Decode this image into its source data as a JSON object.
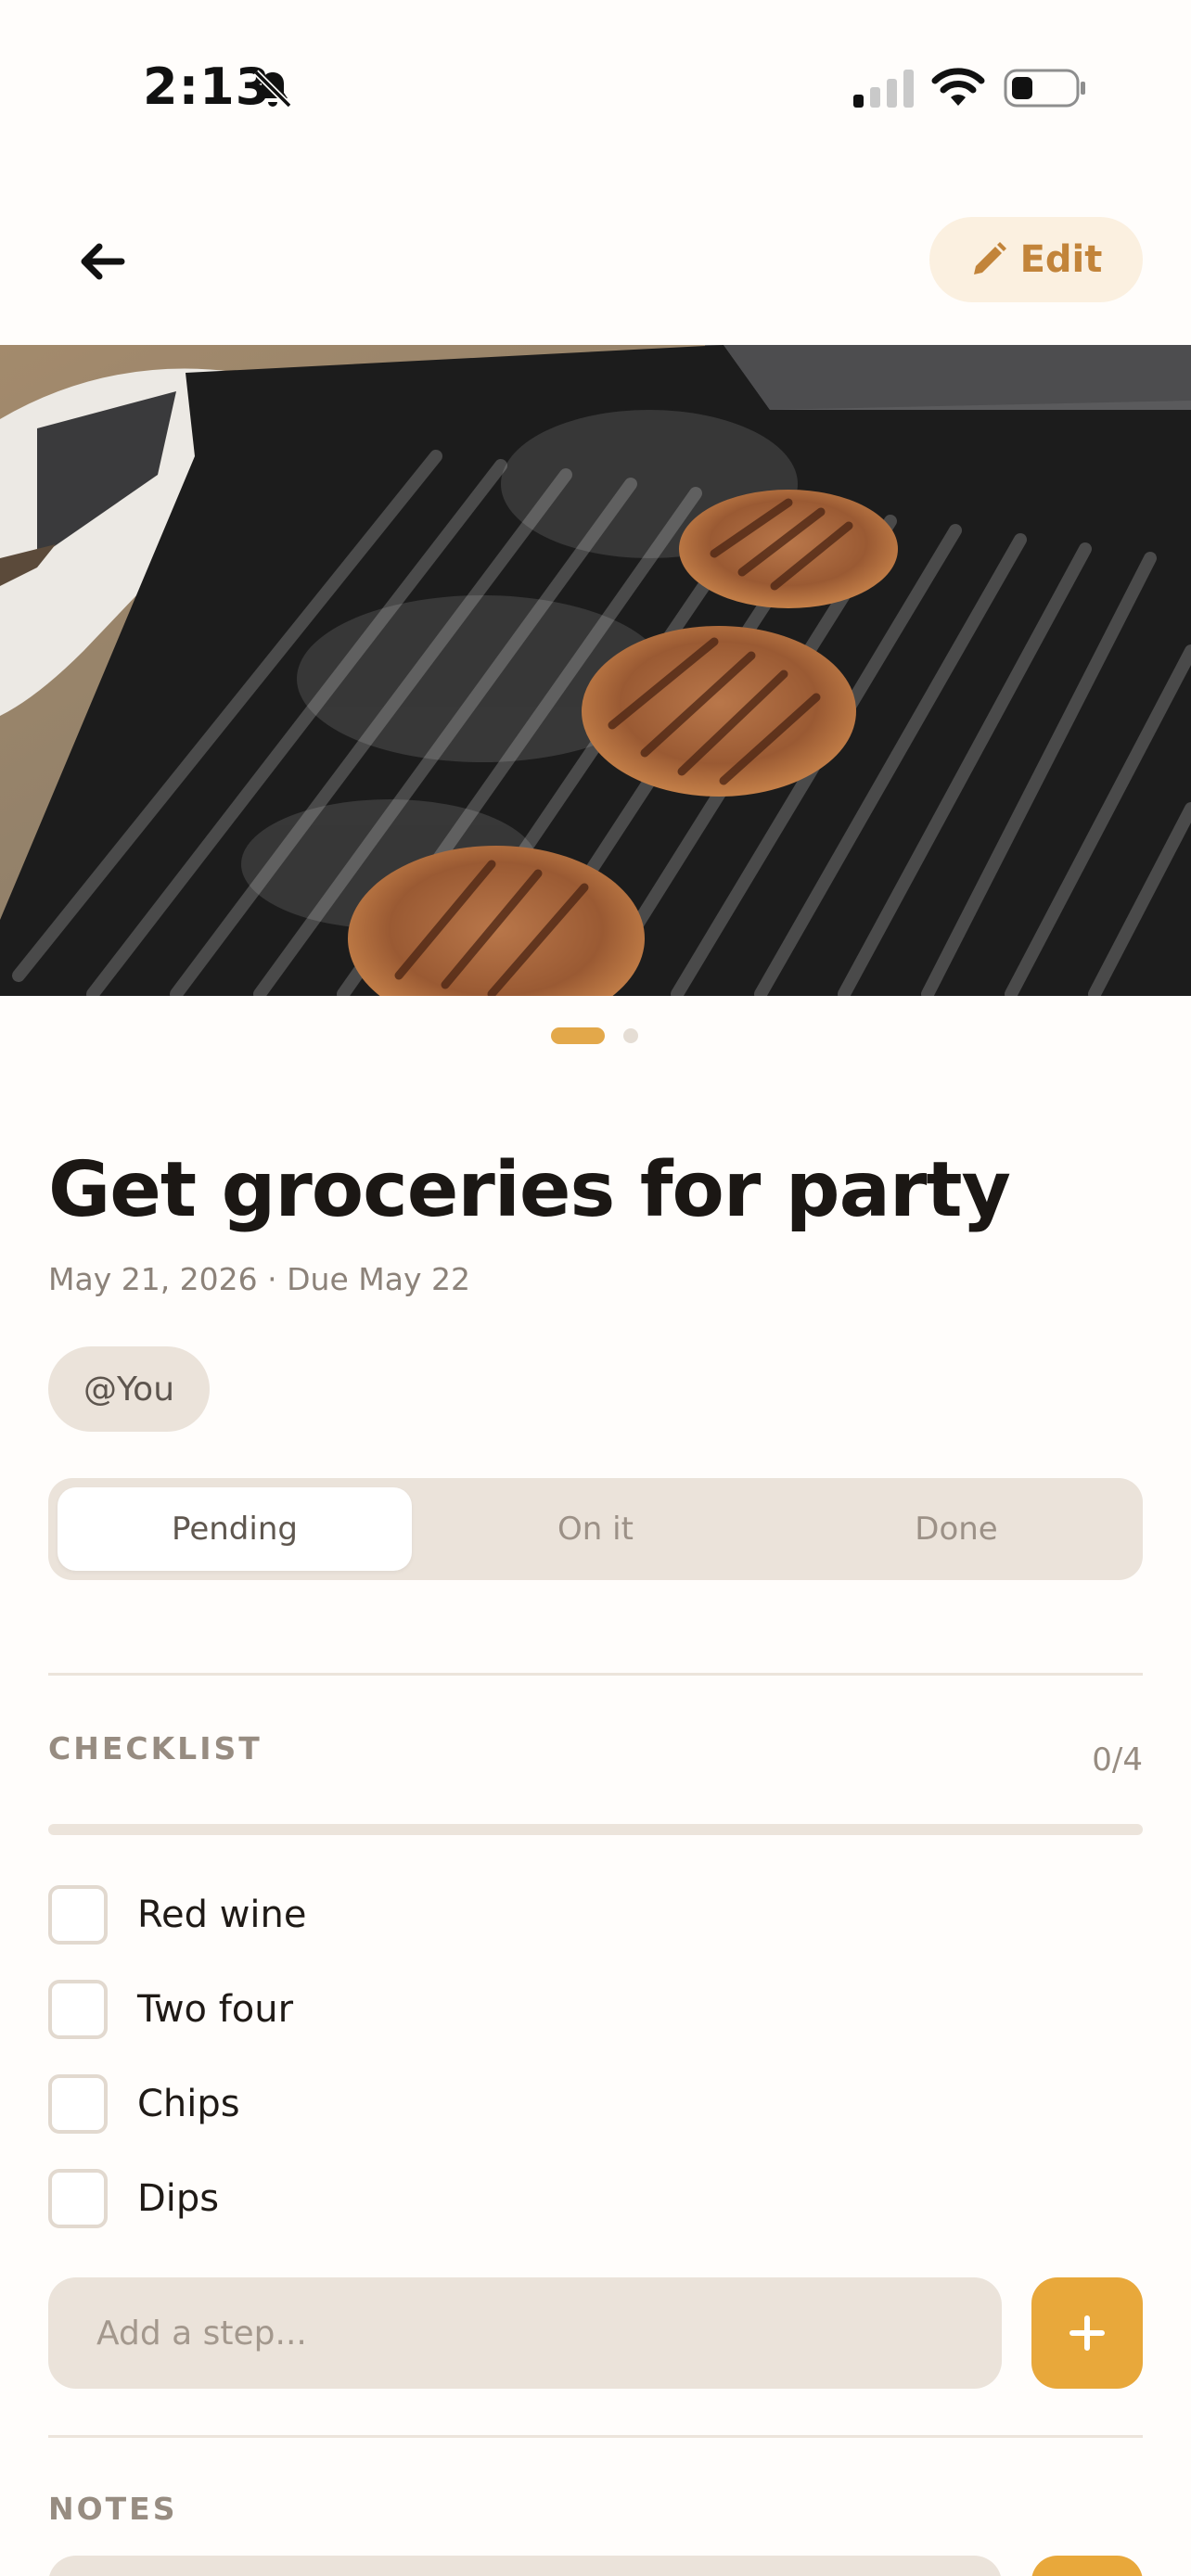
{
  "status_bar": {
    "time": "2:13"
  },
  "header": {
    "edit_label": "Edit"
  },
  "gallery": {
    "image_count": 2,
    "active_index": 0
  },
  "task": {
    "title": "Get groceries for party",
    "meta": "May 21, 2026 · Due May 22",
    "assignee": "@You"
  },
  "status_tabs": [
    {
      "label": "Pending",
      "selected": true
    },
    {
      "label": "On it",
      "selected": false
    },
    {
      "label": "Done",
      "selected": false
    }
  ],
  "checklist": {
    "label": "CHECKLIST",
    "count": "0/4",
    "progress": 0,
    "items": [
      {
        "label": "Red wine",
        "checked": false
      },
      {
        "label": "Two four",
        "checked": false
      },
      {
        "label": "Chips",
        "checked": false
      },
      {
        "label": "Dips",
        "checked": false
      }
    ],
    "add_placeholder": "Add a step..."
  },
  "notes": {
    "label": "NOTES"
  },
  "colors": {
    "accent": "#e8a83b",
    "chip_bg": "#ebe3da",
    "background": "#fffdfb"
  }
}
